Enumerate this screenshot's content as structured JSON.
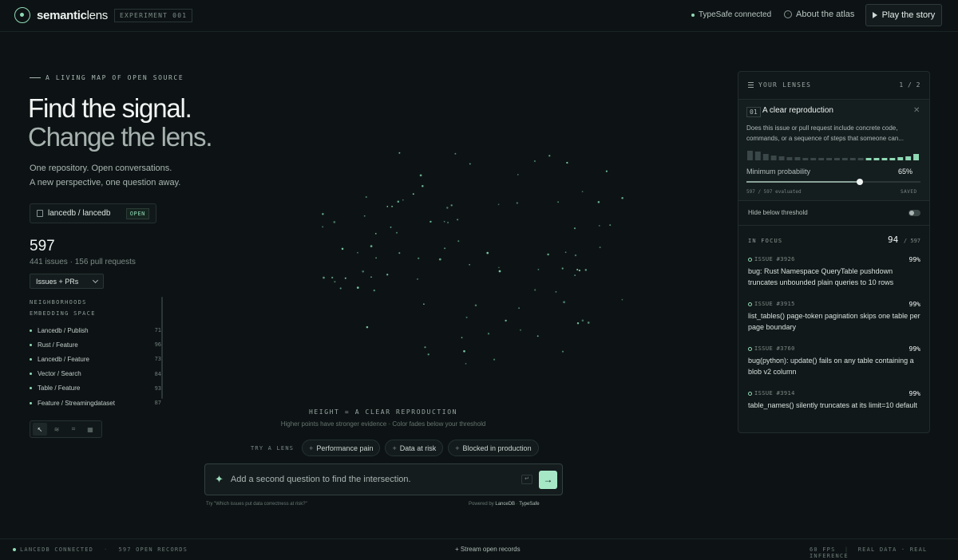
{
  "header": {
    "logo_bold": "semantic",
    "logo_thin": "lens",
    "experiment": "EXPERIMENT 001",
    "connection": "TypeSafe connected",
    "about": "About the atlas",
    "play": "Play the story"
  },
  "hero": {
    "eyebrow": "A LIVING MAP OF OPEN SOURCE",
    "line1": "Find the signal.",
    "line2": "Change the lens.",
    "sub1": "One repository. Open conversations.",
    "sub2": "A new perspective, one question away."
  },
  "repo": {
    "name": "lancedb / lancedb",
    "status": "OPEN"
  },
  "stats": {
    "total": "597",
    "breakdown": "441 issues · 156 pull requests",
    "filter": "Issues + PRs"
  },
  "neighborhoods": {
    "title1": "NEIGHBORHOODS",
    "title2": "EMBEDDING SPACE",
    "items": [
      {
        "label": "Lancedb / Publish",
        "count": "71"
      },
      {
        "label": "Rust / Feature",
        "count": "96"
      },
      {
        "label": "Lancedb / Feature",
        "count": "73"
      },
      {
        "label": "Vector / Search",
        "count": "84"
      },
      {
        "label": "Table / Feature",
        "count": "93"
      },
      {
        "label": "Feature / Streamingdataset",
        "count": "87"
      }
    ]
  },
  "canvas": {
    "caption": "HEIGHT = A CLEAR REPRODUCTION",
    "subcaption": "Higher points have stronger evidence · Color fades below your threshold"
  },
  "lenses": {
    "try_label": "TRY A LENS",
    "chips": [
      "Performance pain",
      "Data at risk",
      "Blocked in production"
    ]
  },
  "ask": {
    "placeholder": "Add a second question to find the intersection.",
    "enter_hint": "↵",
    "hint": "Try \"Which issues put data correctness at risk?\"",
    "powered_prefix": "Powered by",
    "powered_a": "LanceDB",
    "powered_b": "TypeSafe"
  },
  "panel": {
    "title": "YOUR LENSES",
    "page": "1 / 2",
    "lens": {
      "number": "01",
      "title": "A clear reproduction",
      "description": "Does this issue or pull request include concrete code, commands, or a sequence of steps that someone can...",
      "min_label": "Minimum probability",
      "min_value": "65%",
      "threshold": 0.65,
      "evaluated": "597 / 597 evaluated",
      "saved": "SAVED"
    },
    "hide_label": "Hide below threshold",
    "focus_label": "IN FOCUS",
    "focus_count": "94",
    "focus_total": "/ 597",
    "issues": [
      {
        "id": "ISSUE #3926",
        "pct": "99%",
        "title": "bug: Rust Namespace QueryTable pushdown truncates unbounded plain queries to 10 rows"
      },
      {
        "id": "ISSUE #3915",
        "pct": "99%",
        "title": "list_tables() page-token pagination skips one table per page boundary"
      },
      {
        "id": "ISSUE #3760",
        "pct": "99%",
        "title": "bug(python): update() fails on any table containing a blob v2 column"
      },
      {
        "id": "ISSUE #3914",
        "pct": "99%",
        "title": "table_names() silently truncates at its limit=10 default"
      }
    ]
  },
  "footer": {
    "left1": "LANCEDB CONNECTED",
    "left2": "597 OPEN RECORDS",
    "mid": "+ Stream open records",
    "fps": "60 FPS",
    "right": "REAL DATA · REAL INFERENCE"
  },
  "colors": {
    "accent": "#8fd9b5",
    "background": "#0d1314",
    "panel": "#111819"
  }
}
